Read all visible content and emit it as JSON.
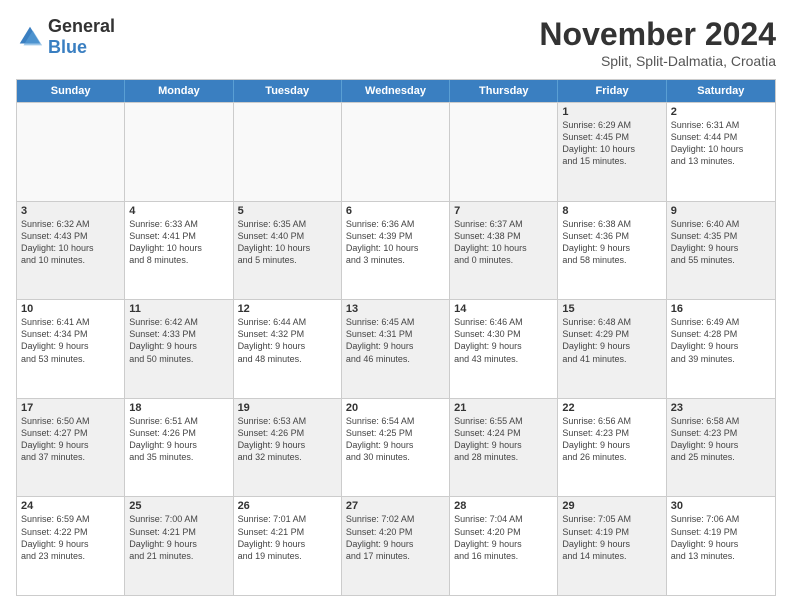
{
  "logo": {
    "general": "General",
    "blue": "Blue"
  },
  "title": "November 2024",
  "location": "Split, Split-Dalmatia, Croatia",
  "header_days": [
    "Sunday",
    "Monday",
    "Tuesday",
    "Wednesday",
    "Thursday",
    "Friday",
    "Saturday"
  ],
  "weeks": [
    [
      {
        "day": "",
        "info": "",
        "empty": true
      },
      {
        "day": "",
        "info": "",
        "empty": true
      },
      {
        "day": "",
        "info": "",
        "empty": true
      },
      {
        "day": "",
        "info": "",
        "empty": true
      },
      {
        "day": "",
        "info": "",
        "empty": true
      },
      {
        "day": "1",
        "info": "Sunrise: 6:29 AM\nSunset: 4:45 PM\nDaylight: 10 hours\nand 15 minutes.",
        "shaded": true
      },
      {
        "day": "2",
        "info": "Sunrise: 6:31 AM\nSunset: 4:44 PM\nDaylight: 10 hours\nand 13 minutes.",
        "shaded": false
      }
    ],
    [
      {
        "day": "3",
        "info": "Sunrise: 6:32 AM\nSunset: 4:43 PM\nDaylight: 10 hours\nand 10 minutes.",
        "shaded": true
      },
      {
        "day": "4",
        "info": "Sunrise: 6:33 AM\nSunset: 4:41 PM\nDaylight: 10 hours\nand 8 minutes.",
        "shaded": false
      },
      {
        "day": "5",
        "info": "Sunrise: 6:35 AM\nSunset: 4:40 PM\nDaylight: 10 hours\nand 5 minutes.",
        "shaded": true
      },
      {
        "day": "6",
        "info": "Sunrise: 6:36 AM\nSunset: 4:39 PM\nDaylight: 10 hours\nand 3 minutes.",
        "shaded": false
      },
      {
        "day": "7",
        "info": "Sunrise: 6:37 AM\nSunset: 4:38 PM\nDaylight: 10 hours\nand 0 minutes.",
        "shaded": true
      },
      {
        "day": "8",
        "info": "Sunrise: 6:38 AM\nSunset: 4:36 PM\nDaylight: 9 hours\nand 58 minutes.",
        "shaded": false
      },
      {
        "day": "9",
        "info": "Sunrise: 6:40 AM\nSunset: 4:35 PM\nDaylight: 9 hours\nand 55 minutes.",
        "shaded": true
      }
    ],
    [
      {
        "day": "10",
        "info": "Sunrise: 6:41 AM\nSunset: 4:34 PM\nDaylight: 9 hours\nand 53 minutes.",
        "shaded": false
      },
      {
        "day": "11",
        "info": "Sunrise: 6:42 AM\nSunset: 4:33 PM\nDaylight: 9 hours\nand 50 minutes.",
        "shaded": true
      },
      {
        "day": "12",
        "info": "Sunrise: 6:44 AM\nSunset: 4:32 PM\nDaylight: 9 hours\nand 48 minutes.",
        "shaded": false
      },
      {
        "day": "13",
        "info": "Sunrise: 6:45 AM\nSunset: 4:31 PM\nDaylight: 9 hours\nand 46 minutes.",
        "shaded": true
      },
      {
        "day": "14",
        "info": "Sunrise: 6:46 AM\nSunset: 4:30 PM\nDaylight: 9 hours\nand 43 minutes.",
        "shaded": false
      },
      {
        "day": "15",
        "info": "Sunrise: 6:48 AM\nSunset: 4:29 PM\nDaylight: 9 hours\nand 41 minutes.",
        "shaded": true
      },
      {
        "day": "16",
        "info": "Sunrise: 6:49 AM\nSunset: 4:28 PM\nDaylight: 9 hours\nand 39 minutes.",
        "shaded": false
      }
    ],
    [
      {
        "day": "17",
        "info": "Sunrise: 6:50 AM\nSunset: 4:27 PM\nDaylight: 9 hours\nand 37 minutes.",
        "shaded": true
      },
      {
        "day": "18",
        "info": "Sunrise: 6:51 AM\nSunset: 4:26 PM\nDaylight: 9 hours\nand 35 minutes.",
        "shaded": false
      },
      {
        "day": "19",
        "info": "Sunrise: 6:53 AM\nSunset: 4:26 PM\nDaylight: 9 hours\nand 32 minutes.",
        "shaded": true
      },
      {
        "day": "20",
        "info": "Sunrise: 6:54 AM\nSunset: 4:25 PM\nDaylight: 9 hours\nand 30 minutes.",
        "shaded": false
      },
      {
        "day": "21",
        "info": "Sunrise: 6:55 AM\nSunset: 4:24 PM\nDaylight: 9 hours\nand 28 minutes.",
        "shaded": true
      },
      {
        "day": "22",
        "info": "Sunrise: 6:56 AM\nSunset: 4:23 PM\nDaylight: 9 hours\nand 26 minutes.",
        "shaded": false
      },
      {
        "day": "23",
        "info": "Sunrise: 6:58 AM\nSunset: 4:23 PM\nDaylight: 9 hours\nand 25 minutes.",
        "shaded": true
      }
    ],
    [
      {
        "day": "24",
        "info": "Sunrise: 6:59 AM\nSunset: 4:22 PM\nDaylight: 9 hours\nand 23 minutes.",
        "shaded": false
      },
      {
        "day": "25",
        "info": "Sunrise: 7:00 AM\nSunset: 4:21 PM\nDaylight: 9 hours\nand 21 minutes.",
        "shaded": true
      },
      {
        "day": "26",
        "info": "Sunrise: 7:01 AM\nSunset: 4:21 PM\nDaylight: 9 hours\nand 19 minutes.",
        "shaded": false
      },
      {
        "day": "27",
        "info": "Sunrise: 7:02 AM\nSunset: 4:20 PM\nDaylight: 9 hours\nand 17 minutes.",
        "shaded": true
      },
      {
        "day": "28",
        "info": "Sunrise: 7:04 AM\nSunset: 4:20 PM\nDaylight: 9 hours\nand 16 minutes.",
        "shaded": false
      },
      {
        "day": "29",
        "info": "Sunrise: 7:05 AM\nSunset: 4:19 PM\nDaylight: 9 hours\nand 14 minutes.",
        "shaded": true
      },
      {
        "day": "30",
        "info": "Sunrise: 7:06 AM\nSunset: 4:19 PM\nDaylight: 9 hours\nand 13 minutes.",
        "shaded": false
      }
    ]
  ]
}
